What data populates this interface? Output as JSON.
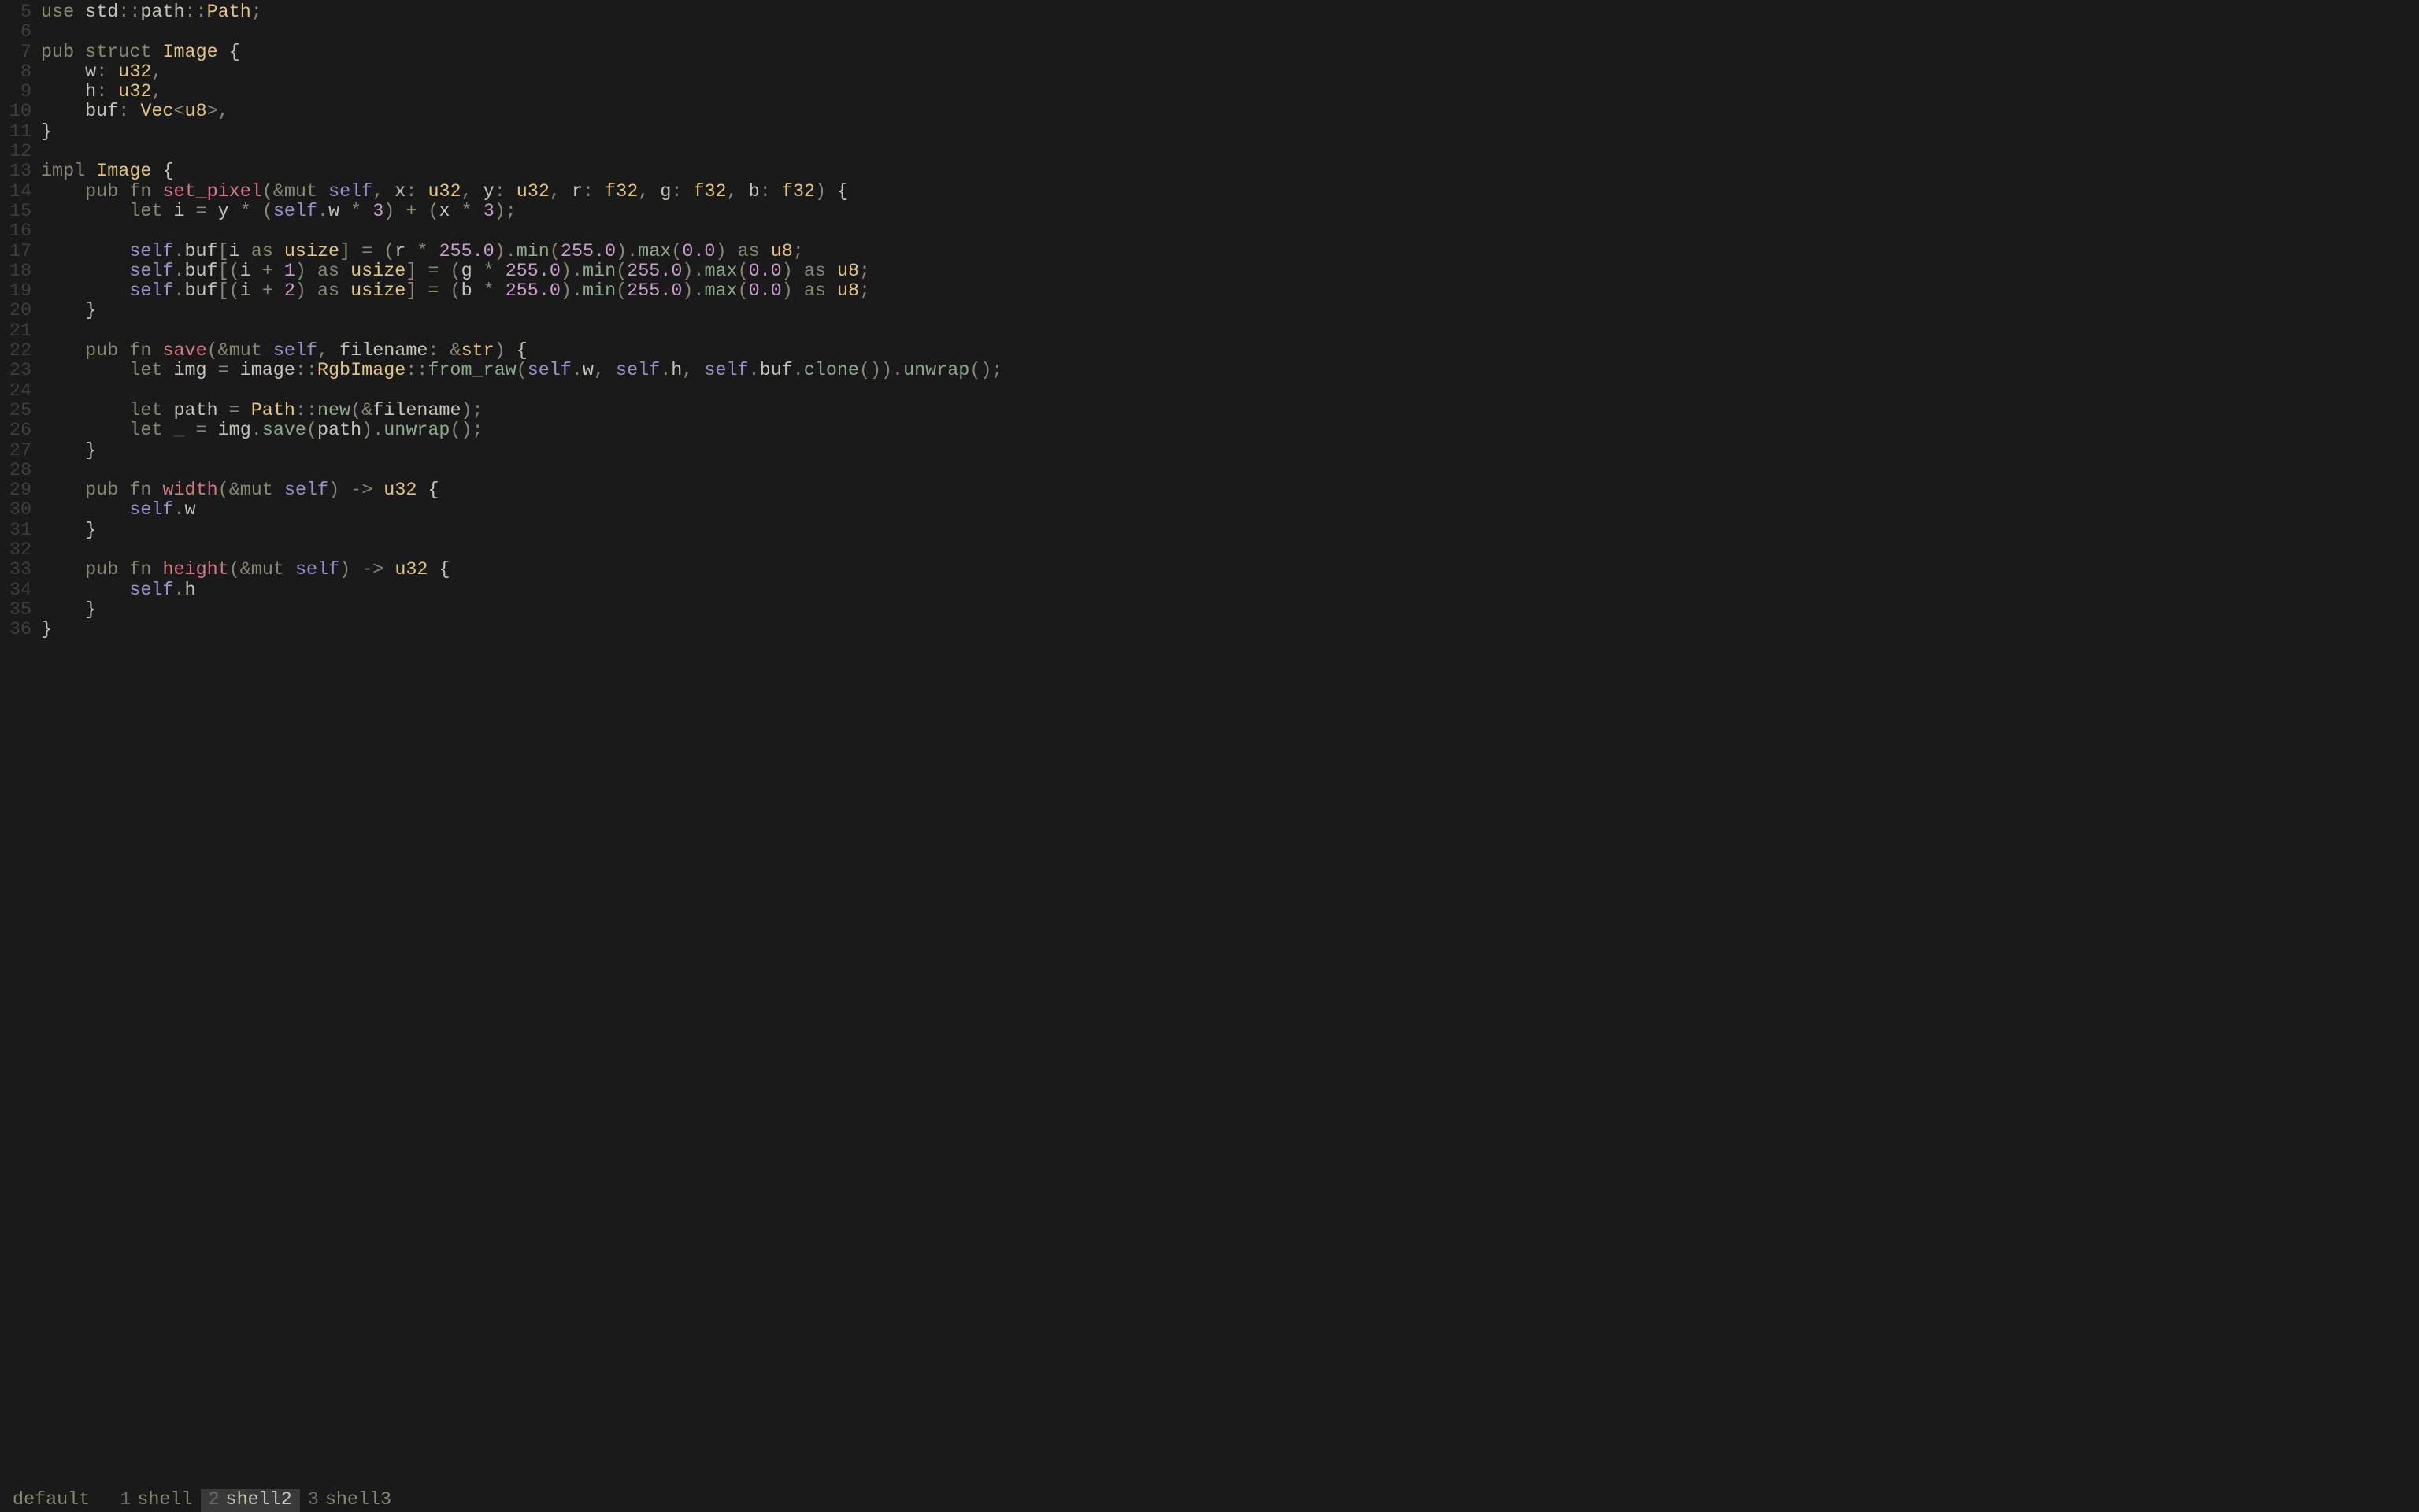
{
  "colors": {
    "bg": "#1a1a1a",
    "fg": "#c8c4bc",
    "gutter": "#3e3e3e",
    "keyword": "#8a8678",
    "type": "#e0c583",
    "function": "#d37b8a",
    "self": "#9a92c9",
    "number": "#c8a0c9",
    "call": "#8fa98f"
  },
  "editor": {
    "first_line_number": 5,
    "lines": [
      [
        [
          "kw",
          "use"
        ],
        [
          "path",
          " std"
        ],
        [
          "punct",
          "::"
        ],
        [
          "path",
          "path"
        ],
        [
          "punct",
          "::"
        ],
        [
          "ty",
          "Path"
        ],
        [
          "punct",
          ";"
        ]
      ],
      [],
      [
        [
          "kw",
          "pub"
        ],
        [
          "path",
          " "
        ],
        [
          "kw",
          "struct"
        ],
        [
          "path",
          " "
        ],
        [
          "ty",
          "Image"
        ],
        [
          "path",
          " "
        ],
        [
          "brace",
          "{"
        ]
      ],
      [
        [
          "path",
          "    w"
        ],
        [
          "punct",
          ":"
        ],
        [
          "path",
          " "
        ],
        [
          "ty",
          "u32"
        ],
        [
          "punct",
          ","
        ]
      ],
      [
        [
          "path",
          "    h"
        ],
        [
          "punct",
          ":"
        ],
        [
          "path",
          " "
        ],
        [
          "ty",
          "u32"
        ],
        [
          "punct",
          ","
        ]
      ],
      [
        [
          "path",
          "    buf"
        ],
        [
          "punct",
          ":"
        ],
        [
          "path",
          " "
        ],
        [
          "ty",
          "Vec"
        ],
        [
          "punct",
          "<"
        ],
        [
          "ty",
          "u8"
        ],
        [
          "punct",
          ">,"
        ]
      ],
      [
        [
          "brace",
          "}"
        ]
      ],
      [],
      [
        [
          "kw",
          "impl"
        ],
        [
          "path",
          " "
        ],
        [
          "ty",
          "Image"
        ],
        [
          "path",
          " "
        ],
        [
          "brace",
          "{"
        ]
      ],
      [
        [
          "path",
          "    "
        ],
        [
          "kw",
          "pub"
        ],
        [
          "path",
          " "
        ],
        [
          "kw",
          "fn"
        ],
        [
          "path",
          " "
        ],
        [
          "fnname",
          "set_pixel"
        ],
        [
          "punct",
          "("
        ],
        [
          "amp",
          "&"
        ],
        [
          "kw",
          "mut"
        ],
        [
          "path",
          " "
        ],
        [
          "selfk",
          "self"
        ],
        [
          "punct",
          ","
        ],
        [
          "path",
          " x"
        ],
        [
          "punct",
          ":"
        ],
        [
          "path",
          " "
        ],
        [
          "ty",
          "u32"
        ],
        [
          "punct",
          ","
        ],
        [
          "path",
          " y"
        ],
        [
          "punct",
          ":"
        ],
        [
          "path",
          " "
        ],
        [
          "ty",
          "u32"
        ],
        [
          "punct",
          ","
        ],
        [
          "path",
          " r"
        ],
        [
          "punct",
          ":"
        ],
        [
          "path",
          " "
        ],
        [
          "ty",
          "f32"
        ],
        [
          "punct",
          ","
        ],
        [
          "path",
          " g"
        ],
        [
          "punct",
          ":"
        ],
        [
          "path",
          " "
        ],
        [
          "ty",
          "f32"
        ],
        [
          "punct",
          ","
        ],
        [
          "path",
          " b"
        ],
        [
          "punct",
          ":"
        ],
        [
          "path",
          " "
        ],
        [
          "ty",
          "f32"
        ],
        [
          "punct",
          ")"
        ],
        [
          "path",
          " "
        ],
        [
          "brace",
          "{"
        ]
      ],
      [
        [
          "path",
          "        "
        ],
        [
          "kw",
          "let"
        ],
        [
          "path",
          " i "
        ],
        [
          "op",
          "="
        ],
        [
          "path",
          " y "
        ],
        [
          "op",
          "*"
        ],
        [
          "path",
          " "
        ],
        [
          "punct",
          "("
        ],
        [
          "selfk",
          "self"
        ],
        [
          "punct",
          "."
        ],
        [
          "path",
          "w "
        ],
        [
          "op",
          "*"
        ],
        [
          "path",
          " "
        ],
        [
          "num",
          "3"
        ],
        [
          "punct",
          ")"
        ],
        [
          "path",
          " "
        ],
        [
          "op",
          "+"
        ],
        [
          "path",
          " "
        ],
        [
          "punct",
          "("
        ],
        [
          "path",
          "x "
        ],
        [
          "op",
          "*"
        ],
        [
          "path",
          " "
        ],
        [
          "num",
          "3"
        ],
        [
          "punct",
          ")"
        ],
        [
          "punct",
          ";"
        ]
      ],
      [],
      [
        [
          "path",
          "        "
        ],
        [
          "selfk",
          "self"
        ],
        [
          "punct",
          "."
        ],
        [
          "path",
          "buf"
        ],
        [
          "punct",
          "["
        ],
        [
          "path",
          "i "
        ],
        [
          "kw",
          "as"
        ],
        [
          "path",
          " "
        ],
        [
          "ty",
          "usize"
        ],
        [
          "punct",
          "]"
        ],
        [
          "path",
          " "
        ],
        [
          "op",
          "="
        ],
        [
          "path",
          " "
        ],
        [
          "punct",
          "("
        ],
        [
          "path",
          "r "
        ],
        [
          "op",
          "*"
        ],
        [
          "path",
          " "
        ],
        [
          "num",
          "255.0"
        ],
        [
          "punct",
          ")."
        ],
        [
          "call",
          "min"
        ],
        [
          "punct",
          "("
        ],
        [
          "num",
          "255.0"
        ],
        [
          "punct",
          ")."
        ],
        [
          "call",
          "max"
        ],
        [
          "punct",
          "("
        ],
        [
          "num",
          "0.0"
        ],
        [
          "punct",
          ")"
        ],
        [
          "path",
          " "
        ],
        [
          "kw",
          "as"
        ],
        [
          "path",
          " "
        ],
        [
          "ty",
          "u8"
        ],
        [
          "punct",
          ";"
        ]
      ],
      [
        [
          "path",
          "        "
        ],
        [
          "selfk",
          "self"
        ],
        [
          "punct",
          "."
        ],
        [
          "path",
          "buf"
        ],
        [
          "punct",
          "[("
        ],
        [
          "path",
          "i "
        ],
        [
          "op",
          "+"
        ],
        [
          "path",
          " "
        ],
        [
          "num",
          "1"
        ],
        [
          "punct",
          ")"
        ],
        [
          "path",
          " "
        ],
        [
          "kw",
          "as"
        ],
        [
          "path",
          " "
        ],
        [
          "ty",
          "usize"
        ],
        [
          "punct",
          "]"
        ],
        [
          "path",
          " "
        ],
        [
          "op",
          "="
        ],
        [
          "path",
          " "
        ],
        [
          "punct",
          "("
        ],
        [
          "path",
          "g "
        ],
        [
          "op",
          "*"
        ],
        [
          "path",
          " "
        ],
        [
          "num",
          "255.0"
        ],
        [
          "punct",
          ")."
        ],
        [
          "call",
          "min"
        ],
        [
          "punct",
          "("
        ],
        [
          "num",
          "255.0"
        ],
        [
          "punct",
          ")."
        ],
        [
          "call",
          "max"
        ],
        [
          "punct",
          "("
        ],
        [
          "num",
          "0.0"
        ],
        [
          "punct",
          ")"
        ],
        [
          "path",
          " "
        ],
        [
          "kw",
          "as"
        ],
        [
          "path",
          " "
        ],
        [
          "ty",
          "u8"
        ],
        [
          "punct",
          ";"
        ]
      ],
      [
        [
          "path",
          "        "
        ],
        [
          "selfk",
          "self"
        ],
        [
          "punct",
          "."
        ],
        [
          "path",
          "buf"
        ],
        [
          "punct",
          "[("
        ],
        [
          "path",
          "i "
        ],
        [
          "op",
          "+"
        ],
        [
          "path",
          " "
        ],
        [
          "num",
          "2"
        ],
        [
          "punct",
          ")"
        ],
        [
          "path",
          " "
        ],
        [
          "kw",
          "as"
        ],
        [
          "path",
          " "
        ],
        [
          "ty",
          "usize"
        ],
        [
          "punct",
          "]"
        ],
        [
          "path",
          " "
        ],
        [
          "op",
          "="
        ],
        [
          "path",
          " "
        ],
        [
          "punct",
          "("
        ],
        [
          "path",
          "b "
        ],
        [
          "op",
          "*"
        ],
        [
          "path",
          " "
        ],
        [
          "num",
          "255.0"
        ],
        [
          "punct",
          ")."
        ],
        [
          "call",
          "min"
        ],
        [
          "punct",
          "("
        ],
        [
          "num",
          "255.0"
        ],
        [
          "punct",
          ")."
        ],
        [
          "call",
          "max"
        ],
        [
          "punct",
          "("
        ],
        [
          "num",
          "0.0"
        ],
        [
          "punct",
          ")"
        ],
        [
          "path",
          " "
        ],
        [
          "kw",
          "as"
        ],
        [
          "path",
          " "
        ],
        [
          "ty",
          "u8"
        ],
        [
          "punct",
          ";"
        ]
      ],
      [
        [
          "path",
          "    "
        ],
        [
          "brace",
          "}"
        ]
      ],
      [],
      [
        [
          "path",
          "    "
        ],
        [
          "kw",
          "pub"
        ],
        [
          "path",
          " "
        ],
        [
          "kw",
          "fn"
        ],
        [
          "path",
          " "
        ],
        [
          "fnname",
          "save"
        ],
        [
          "punct",
          "("
        ],
        [
          "amp",
          "&"
        ],
        [
          "kw",
          "mut"
        ],
        [
          "path",
          " "
        ],
        [
          "selfk",
          "self"
        ],
        [
          "punct",
          ","
        ],
        [
          "path",
          " filename"
        ],
        [
          "punct",
          ":"
        ],
        [
          "path",
          " "
        ],
        [
          "amp",
          "&"
        ],
        [
          "ty",
          "str"
        ],
        [
          "punct",
          ")"
        ],
        [
          "path",
          " "
        ],
        [
          "brace",
          "{"
        ]
      ],
      [
        [
          "path",
          "        "
        ],
        [
          "kw",
          "let"
        ],
        [
          "path",
          " img "
        ],
        [
          "op",
          "="
        ],
        [
          "path",
          " image"
        ],
        [
          "punct",
          "::"
        ],
        [
          "ty",
          "RgbImage"
        ],
        [
          "punct",
          "::"
        ],
        [
          "call",
          "from_raw"
        ],
        [
          "punct",
          "("
        ],
        [
          "selfk",
          "self"
        ],
        [
          "punct",
          "."
        ],
        [
          "path",
          "w"
        ],
        [
          "punct",
          ","
        ],
        [
          "path",
          " "
        ],
        [
          "selfk",
          "self"
        ],
        [
          "punct",
          "."
        ],
        [
          "path",
          "h"
        ],
        [
          "punct",
          ","
        ],
        [
          "path",
          " "
        ],
        [
          "selfk",
          "self"
        ],
        [
          "punct",
          "."
        ],
        [
          "path",
          "buf"
        ],
        [
          "punct",
          "."
        ],
        [
          "call",
          "clone"
        ],
        [
          "punct",
          "())."
        ],
        [
          "call",
          "unwrap"
        ],
        [
          "punct",
          "();"
        ]
      ],
      [],
      [
        [
          "path",
          "        "
        ],
        [
          "kw",
          "let"
        ],
        [
          "path",
          " path "
        ],
        [
          "op",
          "="
        ],
        [
          "path",
          " "
        ],
        [
          "ty",
          "Path"
        ],
        [
          "punct",
          "::"
        ],
        [
          "call",
          "new"
        ],
        [
          "punct",
          "("
        ],
        [
          "amp",
          "&"
        ],
        [
          "path",
          "filename"
        ],
        [
          "punct",
          ");"
        ]
      ],
      [
        [
          "path",
          "        "
        ],
        [
          "kw",
          "let"
        ],
        [
          "path",
          " "
        ],
        [
          "under",
          "_"
        ],
        [
          "path",
          " "
        ],
        [
          "op",
          "="
        ],
        [
          "path",
          " img"
        ],
        [
          "punct",
          "."
        ],
        [
          "call",
          "save"
        ],
        [
          "punct",
          "("
        ],
        [
          "path",
          "path"
        ],
        [
          "punct",
          ")."
        ],
        [
          "call",
          "unwrap"
        ],
        [
          "punct",
          "();"
        ]
      ],
      [
        [
          "path",
          "    "
        ],
        [
          "brace",
          "}"
        ]
      ],
      [],
      [
        [
          "path",
          "    "
        ],
        [
          "kw",
          "pub"
        ],
        [
          "path",
          " "
        ],
        [
          "kw",
          "fn"
        ],
        [
          "path",
          " "
        ],
        [
          "fnname",
          "width"
        ],
        [
          "punct",
          "("
        ],
        [
          "amp",
          "&"
        ],
        [
          "kw",
          "mut"
        ],
        [
          "path",
          " "
        ],
        [
          "selfk",
          "self"
        ],
        [
          "punct",
          ")"
        ],
        [
          "path",
          " "
        ],
        [
          "op",
          "->"
        ],
        [
          "path",
          " "
        ],
        [
          "ty",
          "u32"
        ],
        [
          "path",
          " "
        ],
        [
          "brace",
          "{"
        ]
      ],
      [
        [
          "path",
          "        "
        ],
        [
          "selfk",
          "self"
        ],
        [
          "punct",
          "."
        ],
        [
          "path",
          "w"
        ]
      ],
      [
        [
          "path",
          "    "
        ],
        [
          "brace",
          "}"
        ]
      ],
      [],
      [
        [
          "path",
          "    "
        ],
        [
          "kw",
          "pub"
        ],
        [
          "path",
          " "
        ],
        [
          "kw",
          "fn"
        ],
        [
          "path",
          " "
        ],
        [
          "fnname",
          "height"
        ],
        [
          "punct",
          "("
        ],
        [
          "amp",
          "&"
        ],
        [
          "kw",
          "mut"
        ],
        [
          "path",
          " "
        ],
        [
          "selfk",
          "self"
        ],
        [
          "punct",
          ")"
        ],
        [
          "path",
          " "
        ],
        [
          "op",
          "->"
        ],
        [
          "path",
          " "
        ],
        [
          "ty",
          "u32"
        ],
        [
          "path",
          " "
        ],
        [
          "brace",
          "{"
        ]
      ],
      [
        [
          "path",
          "        "
        ],
        [
          "selfk",
          "self"
        ],
        [
          "punct",
          "."
        ],
        [
          "path",
          "h"
        ]
      ],
      [
        [
          "path",
          "    "
        ],
        [
          "brace",
          "}"
        ]
      ],
      [
        [
          "brace",
          "}"
        ]
      ]
    ]
  },
  "statusbar": {
    "session": "default",
    "windows": [
      {
        "index": "1",
        "name": "shell",
        "active": false
      },
      {
        "index": "2",
        "name": "shell2",
        "active": true
      },
      {
        "index": "3",
        "name": "shell3",
        "active": false
      }
    ]
  }
}
